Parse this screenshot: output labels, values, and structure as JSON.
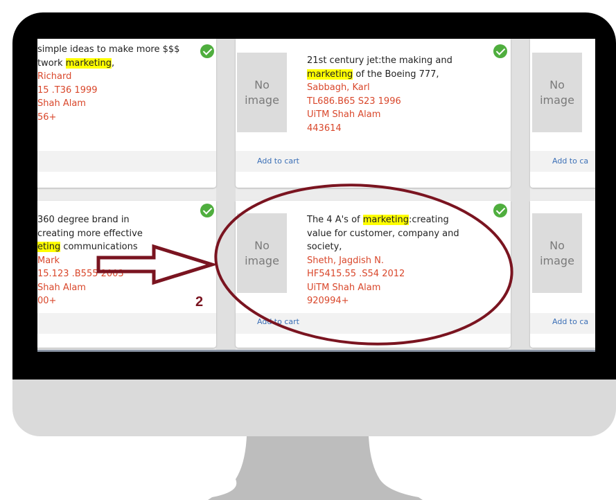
{
  "search_results": [
    {
      "row": 1,
      "col": 1,
      "title_lines": [
        "simple ideas to make more $$$",
        "twork ",
        "marketing",
        ","
      ],
      "author": "Richard",
      "call_number": "15 .T36 1999",
      "library": "Shah Alam",
      "barcode": "56+",
      "cart_label": "",
      "checked": true
    },
    {
      "row": 1,
      "col": 2,
      "title_line1": "21st century jet:the making and",
      "title_highlight": "marketing",
      "title_rest": " of the Boeing 777,",
      "author": "Sabbagh, Karl",
      "call_number": "TL686.B65 S23 1996",
      "library": "UiTM Shah Alam",
      "barcode": "443614",
      "cart_label": "Add to cart",
      "no_image": "No image",
      "checked": true
    },
    {
      "row": 1,
      "col": 3,
      "no_image": "No image",
      "cart_label": "Add to ca"
    },
    {
      "row": 2,
      "col": 1,
      "title_lines": [
        "360 degree brand in",
        "creating more effective",
        "eting",
        " communications"
      ],
      "author": "Mark",
      "call_number": "15.123 .B555 2003",
      "library": "Shah Alam",
      "barcode": "00+",
      "cart_label": "",
      "checked": true
    },
    {
      "row": 2,
      "col": 2,
      "title_prefix": "The 4 A's of ",
      "title_highlight": "marketing",
      "title_rest": ":creating",
      "title_line2": "value for customer, company and",
      "title_line3": "society,",
      "author": "Sheth, Jagdish N.",
      "call_number": "HF5415.55 .S54 2012",
      "library": "UiTM Shah Alam",
      "barcode": "920994+",
      "cart_label": "Add to cart",
      "no_image": "No image",
      "checked": true
    },
    {
      "row": 2,
      "col": 3,
      "no_image": "No image",
      "cart_label": "Add to ca"
    }
  ],
  "annotation": {
    "step_number": "2",
    "color": "#7a1420"
  },
  "colors": {
    "highlight": "#ffff00",
    "meta_text": "#d9472b",
    "link": "#3b6fb6",
    "check": "#4fae3e"
  },
  "icons": [
    "check-circle-icon",
    "no-image-placeholder"
  ]
}
